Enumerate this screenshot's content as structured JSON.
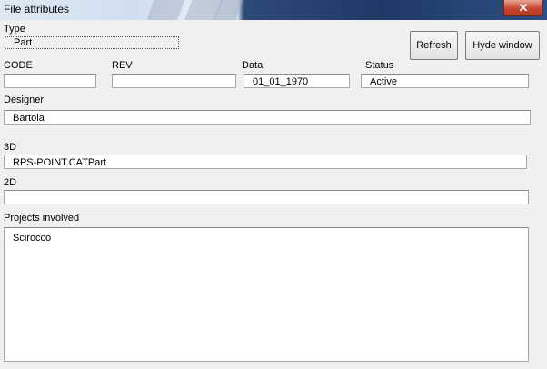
{
  "window": {
    "title": "File attributes",
    "close_glyph": "✕"
  },
  "type": {
    "label": "Type",
    "value": "Part"
  },
  "buttons": {
    "refresh": "Refresh",
    "hide_window": "Hyde window"
  },
  "code": {
    "label": "CODE",
    "value": ""
  },
  "rev": {
    "label": "REV",
    "value": ""
  },
  "data": {
    "label": "Data",
    "value": "01_01_1970"
  },
  "status": {
    "label": "Status",
    "value": "Active"
  },
  "designer": {
    "label": "Designer",
    "value": "Bartola"
  },
  "file3d": {
    "label": "3D",
    "value": "RPS-POINT.CATPart"
  },
  "file2d": {
    "label": "2D",
    "value": ""
  },
  "projects": {
    "label": "Projects involved",
    "value": "Scirocco"
  },
  "icons": {
    "close": "close-icon"
  }
}
